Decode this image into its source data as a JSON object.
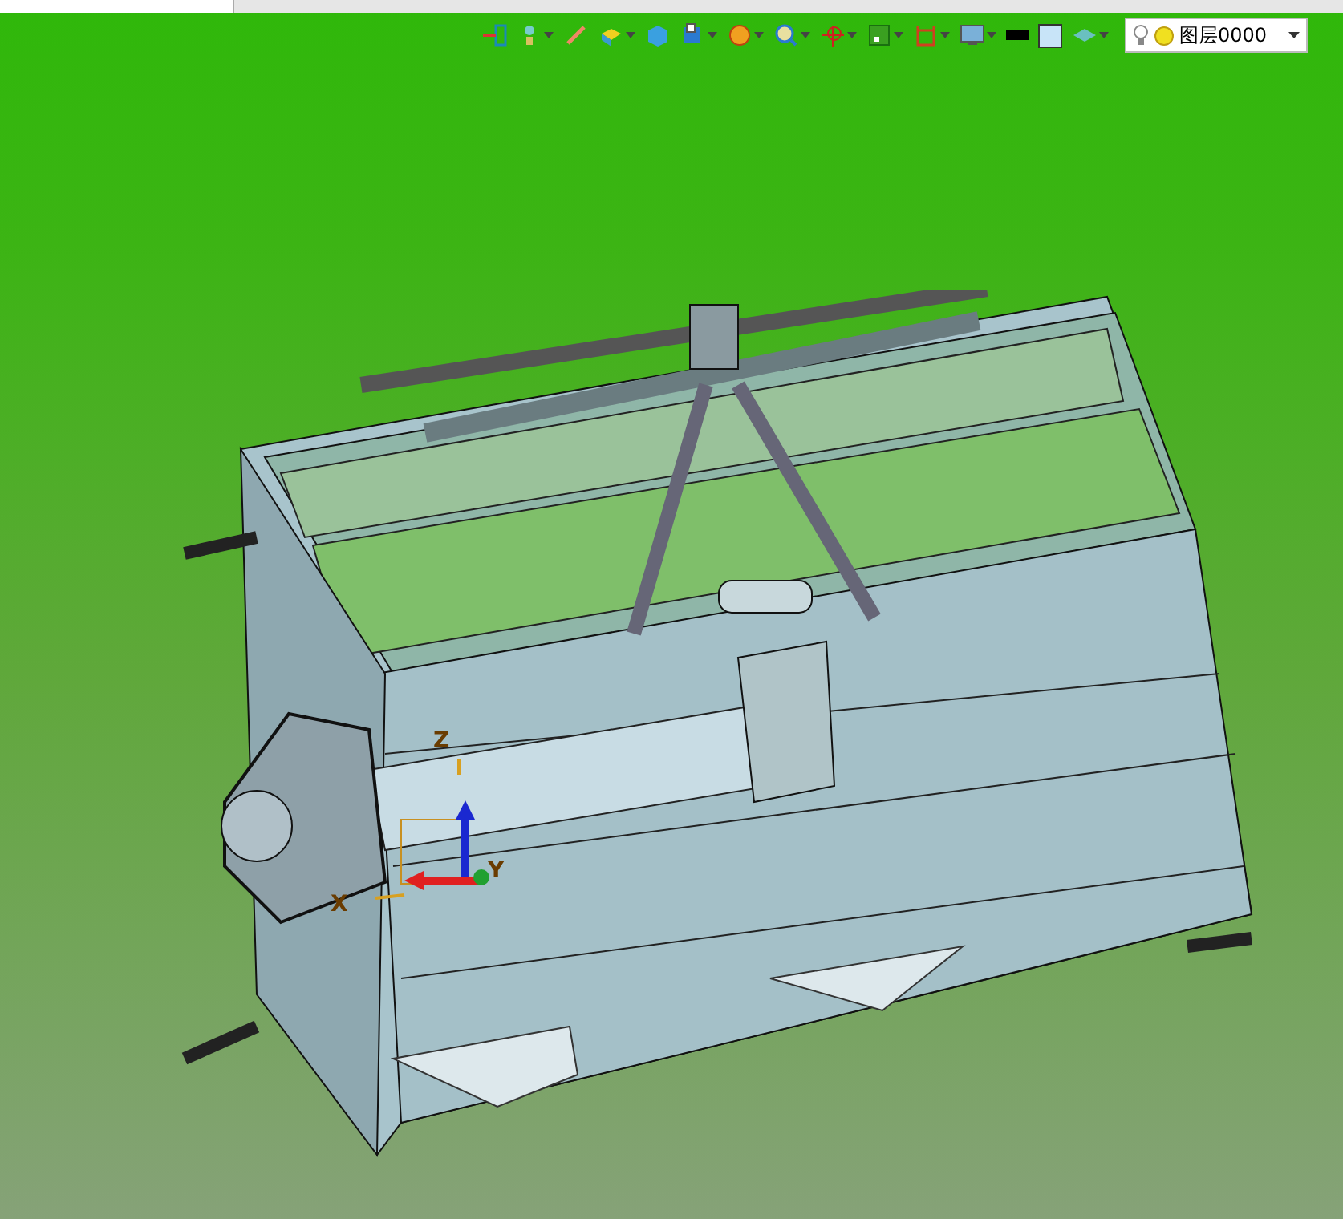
{
  "toolbar": {
    "layer_select": {
      "value": "图层0000"
    }
  },
  "viewport": {
    "axes": [
      {
        "label": "Z",
        "kind": "z"
      },
      {
        "label": "X",
        "kind": "x"
      },
      {
        "label": "Y",
        "kind": "y"
      }
    ]
  }
}
